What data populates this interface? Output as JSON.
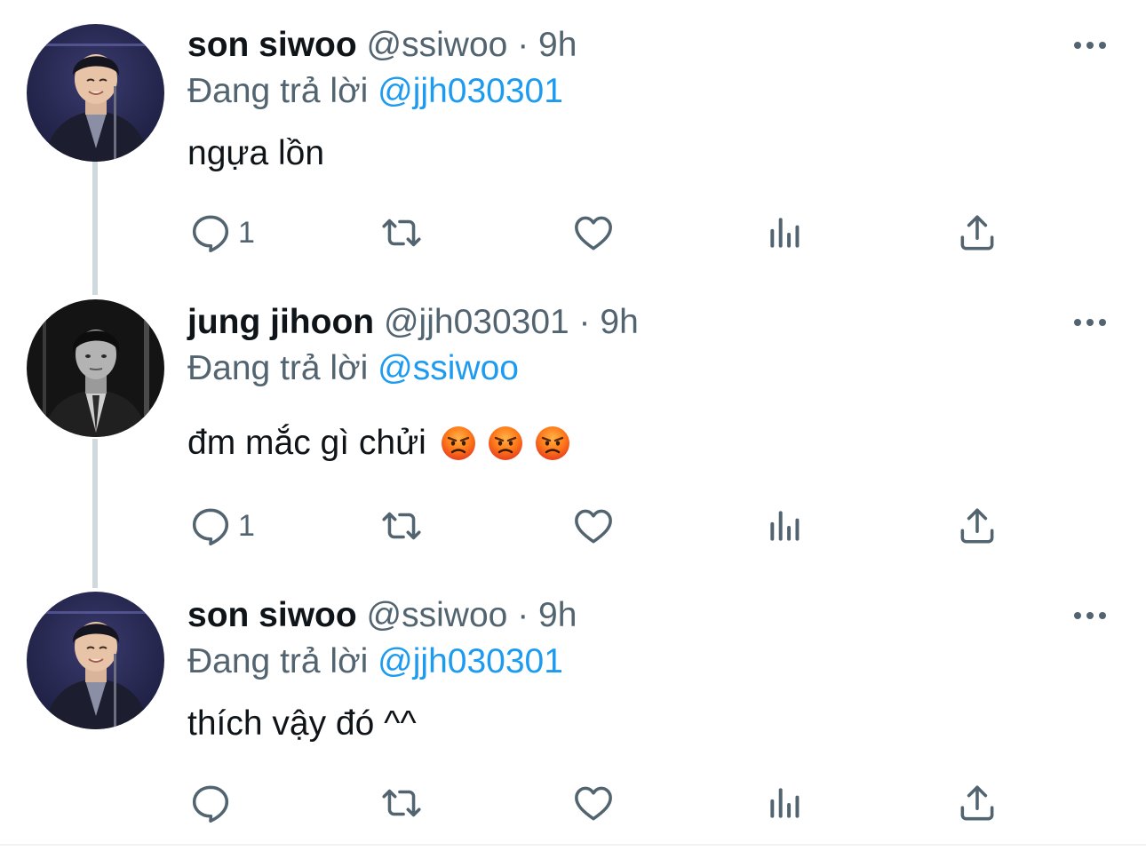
{
  "colors": {
    "accent": "#1d9bf0",
    "text": "#0f1419",
    "muted": "#536471",
    "thread": "#cfd9de"
  },
  "tweets": [
    {
      "name": "son siwoo",
      "handle": "@ssiwoo",
      "separator": "·",
      "time": "9h",
      "replying_prefix": "Đang trả lời",
      "replying_to": "@jjh030301",
      "text": "ngựa lồn",
      "reply_count": "1",
      "avatar_icon": "avatar-photo-son-siwoo"
    },
    {
      "name": "jung jihoon",
      "handle": "@jjh030301",
      "separator": "·",
      "time": "9h",
      "replying_prefix": "Đang trả lời",
      "replying_to": "@ssiwoo",
      "text": "đm mắc gì chửi",
      "emojis": [
        "angry-face-emoji",
        "angry-face-emoji",
        "angry-face-emoji"
      ],
      "reply_count": "1",
      "avatar_icon": "avatar-photo-jung-jihoon"
    },
    {
      "name": "son siwoo",
      "handle": "@ssiwoo",
      "separator": "·",
      "time": "9h",
      "replying_prefix": "Đang trả lời",
      "replying_to": "@jjh030301",
      "text": "thích vậy đó ^^",
      "reply_count": "",
      "avatar_icon": "avatar-photo-son-siwoo"
    }
  ],
  "action_icons": [
    "reply-icon",
    "retweet-icon",
    "like-icon",
    "analytics-icon",
    "share-icon"
  ]
}
